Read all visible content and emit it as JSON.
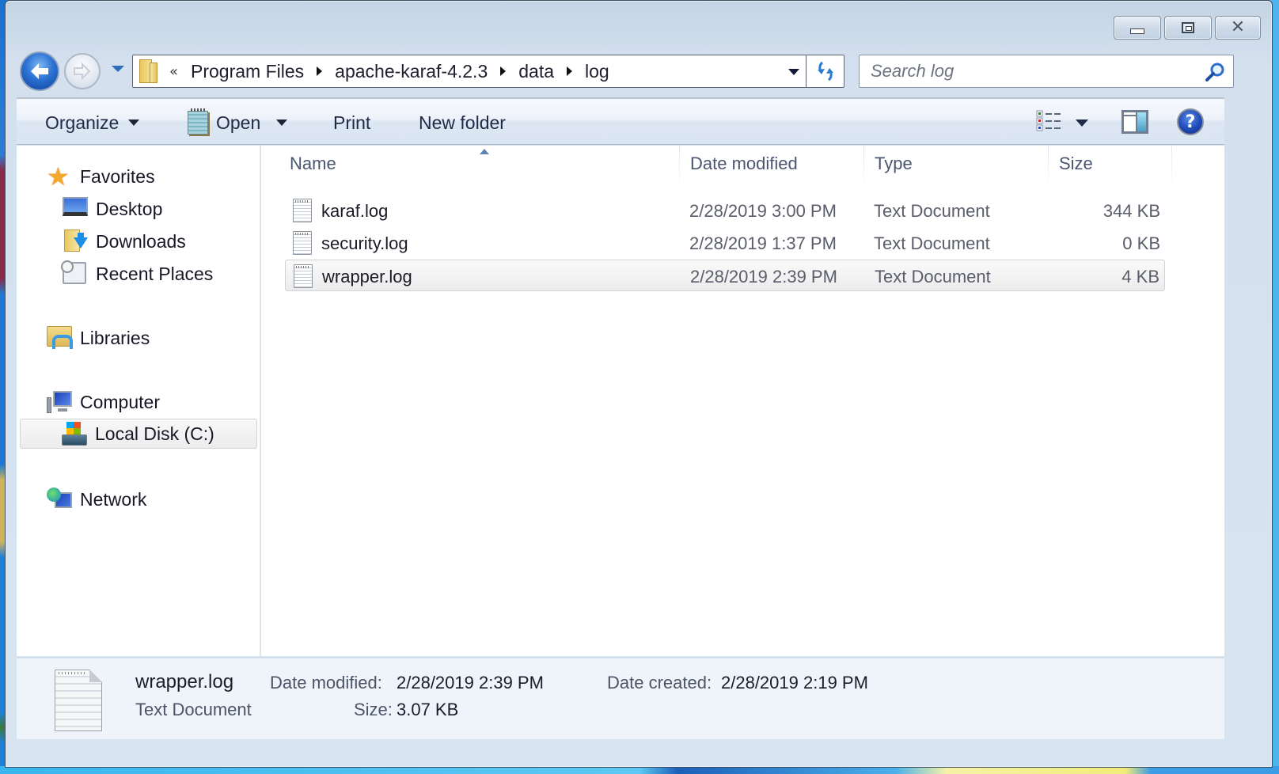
{
  "window": {
    "controls": {
      "minimize": "minimize",
      "maximize": "maximize",
      "close": "close"
    }
  },
  "navigation": {
    "back_icon": "back-arrow-icon",
    "forward_icon": "forward-arrow-icon",
    "recent_pages_icon": "chevron-down-icon"
  },
  "address_bar": {
    "overflow_chevron": "«",
    "breadcrumbs": [
      "Program Files",
      "apache-karaf-4.2.3",
      "data",
      "log"
    ]
  },
  "search": {
    "placeholder": "Search log",
    "value": ""
  },
  "toolbar": {
    "organize_label": "Organize",
    "open_label": "Open",
    "print_label": "Print",
    "new_folder_label": "New folder",
    "help_label": "?"
  },
  "sidebar": {
    "favorites": {
      "label": "Favorites",
      "items": [
        {
          "label": "Desktop"
        },
        {
          "label": "Downloads"
        },
        {
          "label": "Recent Places"
        }
      ]
    },
    "libraries": {
      "label": "Libraries"
    },
    "computer": {
      "label": "Computer",
      "items": [
        {
          "label": "Local Disk (C:)",
          "selected": true
        }
      ]
    },
    "network": {
      "label": "Network"
    }
  },
  "file_list": {
    "columns": {
      "name": "Name",
      "date": "Date modified",
      "type": "Type",
      "size": "Size"
    },
    "sort_column": "Name",
    "sort_direction": "ascending",
    "rows": [
      {
        "name": "karaf.log",
        "date": "2/28/2019 3:00 PM",
        "type": "Text Document",
        "size": "344 KB",
        "selected": false
      },
      {
        "name": "security.log",
        "date": "2/28/2019 1:37 PM",
        "type": "Text Document",
        "size": "0 KB",
        "selected": false
      },
      {
        "name": "wrapper.log",
        "date": "2/28/2019 2:39 PM",
        "type": "Text Document",
        "size": "4 KB",
        "selected": true
      }
    ]
  },
  "details": {
    "file_name": "wrapper.log",
    "file_type": "Text Document",
    "date_modified_label": "Date modified:",
    "date_modified": "2/28/2019 2:39 PM",
    "size_label": "Size:",
    "size": "3.07 KB",
    "date_created_label": "Date created:",
    "date_created": "2/28/2019 2:19 PM"
  }
}
